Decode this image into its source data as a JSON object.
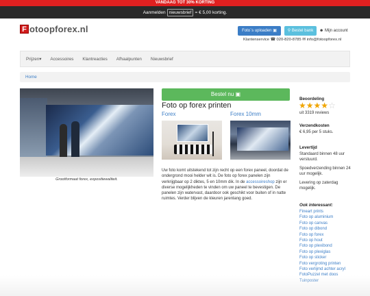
{
  "promo": {
    "text": "VANDAAG TOT 30% KORTING"
  },
  "newsletter": {
    "prefix": "Aanmelden",
    "button": "nieuwsbrief",
    "suffix": "= € 5,00 korting."
  },
  "logo": {
    "letter": "F",
    "rest": "otoopforex.nl"
  },
  "header": {
    "upload_label": "Foto`s uploaden",
    "bestel_label": "Bestel bank",
    "account_label": "Mijn account",
    "contact": {
      "label": "Klantenservice",
      "phone": "020-820-8785",
      "email": "info@fotoopforex.nl"
    }
  },
  "nav": {
    "items": [
      "Prijzen",
      "Accessoires",
      "Klantreacties",
      "Afhaalpunten",
      "Nieuwsbrief"
    ]
  },
  "breadcrumb": {
    "home": "Home"
  },
  "hero": {
    "caption": "Grootformaat forex, expositiewaliteit."
  },
  "product": {
    "order_button": "Bestel nu",
    "title": "Foto op forex printen",
    "variants": [
      "Forex",
      "Forex 10mm"
    ],
    "description_1": "Uw foto komt uitstekend tot zijn recht op een forex paneel, doordat de ondergrond mooi helder wit is. De foto op forex panelen zijn verkrijgbaar op 2 diktes, 5 en 10mm dik. In de ",
    "description_link": "accessoireshop",
    "description_2": " zijn er diverse mogelijkheden te vinden om uw paneel te bevestigen. De panelen zijn watervast, daardoor ook geschikt voor buiten of in natte ruimtes. Verder blijven de kleuren jarenlang goed."
  },
  "sidebar": {
    "rating_heading": "Beoordeling",
    "rating": {
      "stars_full": 4,
      "stars_total": 5
    },
    "reviews": "uit 3319 reviews",
    "shipping_heading": "Verzendkosten",
    "shipping_text": "€ 6,95 per 5 stuks.",
    "delivery_heading": "Levertijd",
    "delivery_text_1": "Standaard binnen 48 uur verstuurd.",
    "delivery_text_2": "Spoedverzending binnen 24 uur mogelijk.",
    "delivery_text_3": "Levering op zaterdag mogelijk.",
    "interesting_heading": "Ook interessant:",
    "links": [
      "Fineart prints",
      "Foto op aluminium",
      "Foto op canvas",
      "Foto op dibond",
      "Foto op forex",
      "Foto op hout",
      "Foto op plexibond",
      "Foto op plexiglas",
      "Foto op sticker",
      "Foto vergroting printen",
      "Foto verlijmd achter acryl",
      "FotoPuzzel met doos",
      "Tuinposter"
    ]
  },
  "colors": {
    "promo": "#e02020",
    "primary": "#3b7dc6",
    "success": "#5cb85c",
    "info": "#5bc0de",
    "star": "#f0a500"
  }
}
